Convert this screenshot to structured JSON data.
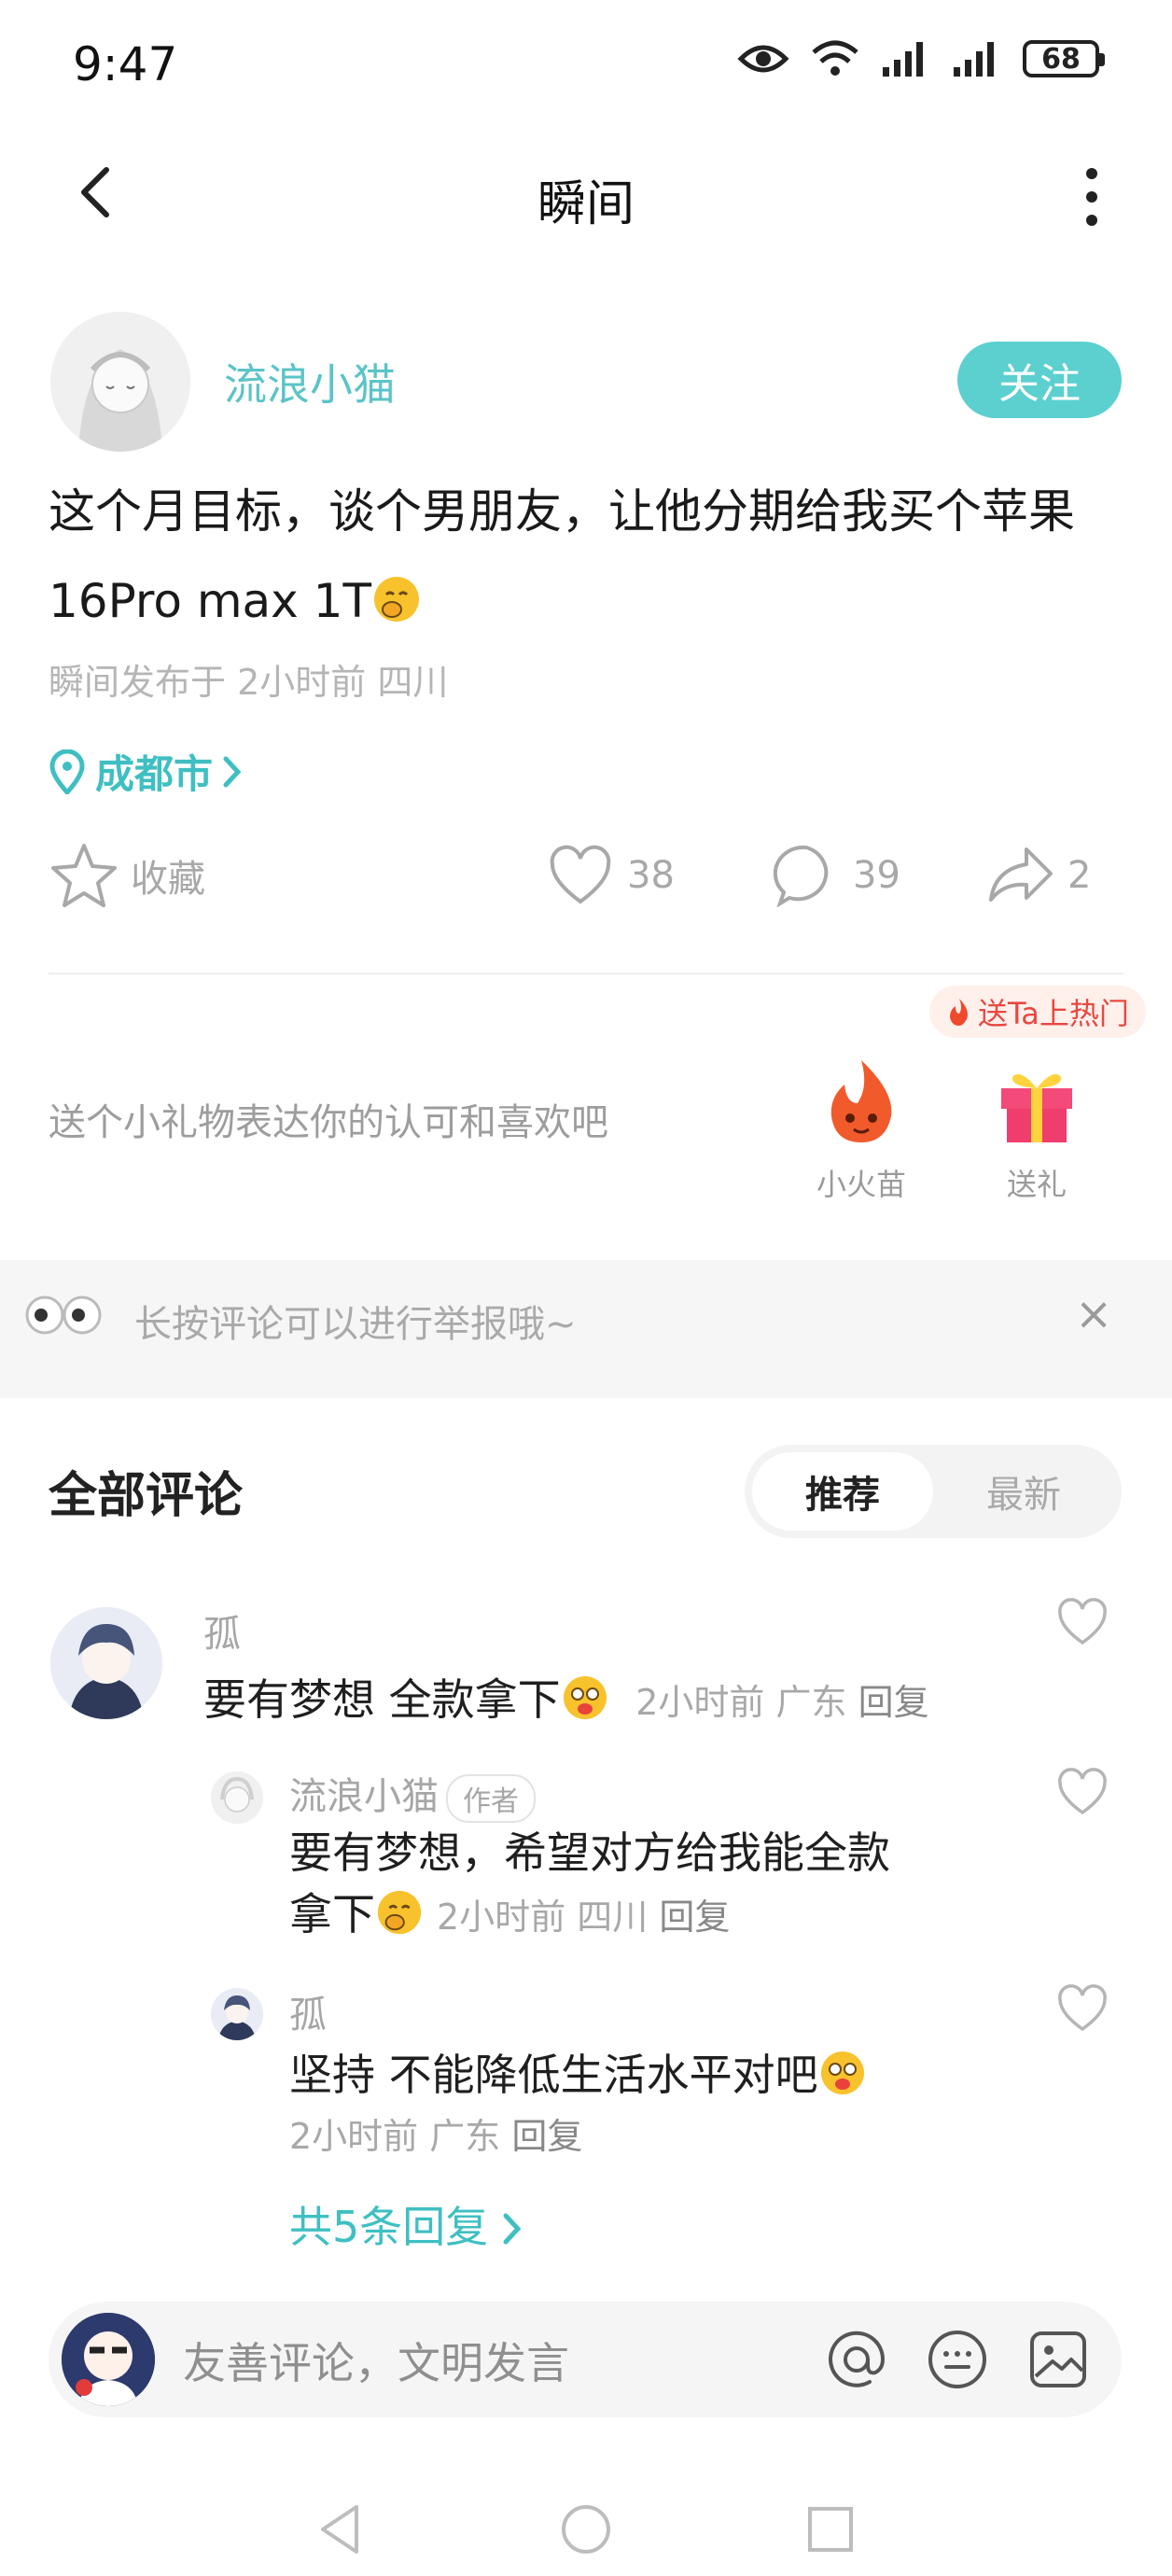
{
  "status_bar": {
    "time": "9:47",
    "battery": "68"
  },
  "nav": {
    "title": "瞬间"
  },
  "post": {
    "author": "流浪小猫",
    "follow_label": "关注",
    "text_line1": "这个月目标，谈个男朋友，让他分期给我买个苹果",
    "text_line2": "16Pro max 1T",
    "meta": "瞬间发布于 2小时前 四川",
    "location": "成都市"
  },
  "actions": {
    "favorite_label": "收藏",
    "likes": "38",
    "comments": "39",
    "shares": "2"
  },
  "gift": {
    "prompt": "送个小礼物表达你的认可和喜欢吧",
    "hot_badge": "送Ta上热门",
    "item1_label": "小火苗",
    "item2_label": "送礼"
  },
  "tip": {
    "text": "长按评论可以进行举报哦~"
  },
  "comments": {
    "title": "全部评论",
    "sort_recommended": "推荐",
    "sort_latest": "最新",
    "items": [
      {
        "name": "孤",
        "text": "要有梦想 全款拿下",
        "time": "2小时前",
        "region": "广东",
        "reply": "回复"
      }
    ],
    "replies": [
      {
        "name": "流浪小猫",
        "tag": "作者",
        "text_line1": "要有梦想，希望对方给我能全款",
        "text_line2": "拿下",
        "time": "2小时前",
        "region": "四川",
        "reply": "回复"
      },
      {
        "name": "孤",
        "text": "坚持 不能降低生活水平对吧",
        "time": "2小时前",
        "region": "广东",
        "reply": "回复"
      }
    ],
    "more_replies": "共5条回复"
  },
  "input": {
    "placeholder": "友善评论，文明发言"
  },
  "colors": {
    "accent": "#5ccfcf",
    "link": "#3fbfc2",
    "hot": "#e8483f"
  }
}
